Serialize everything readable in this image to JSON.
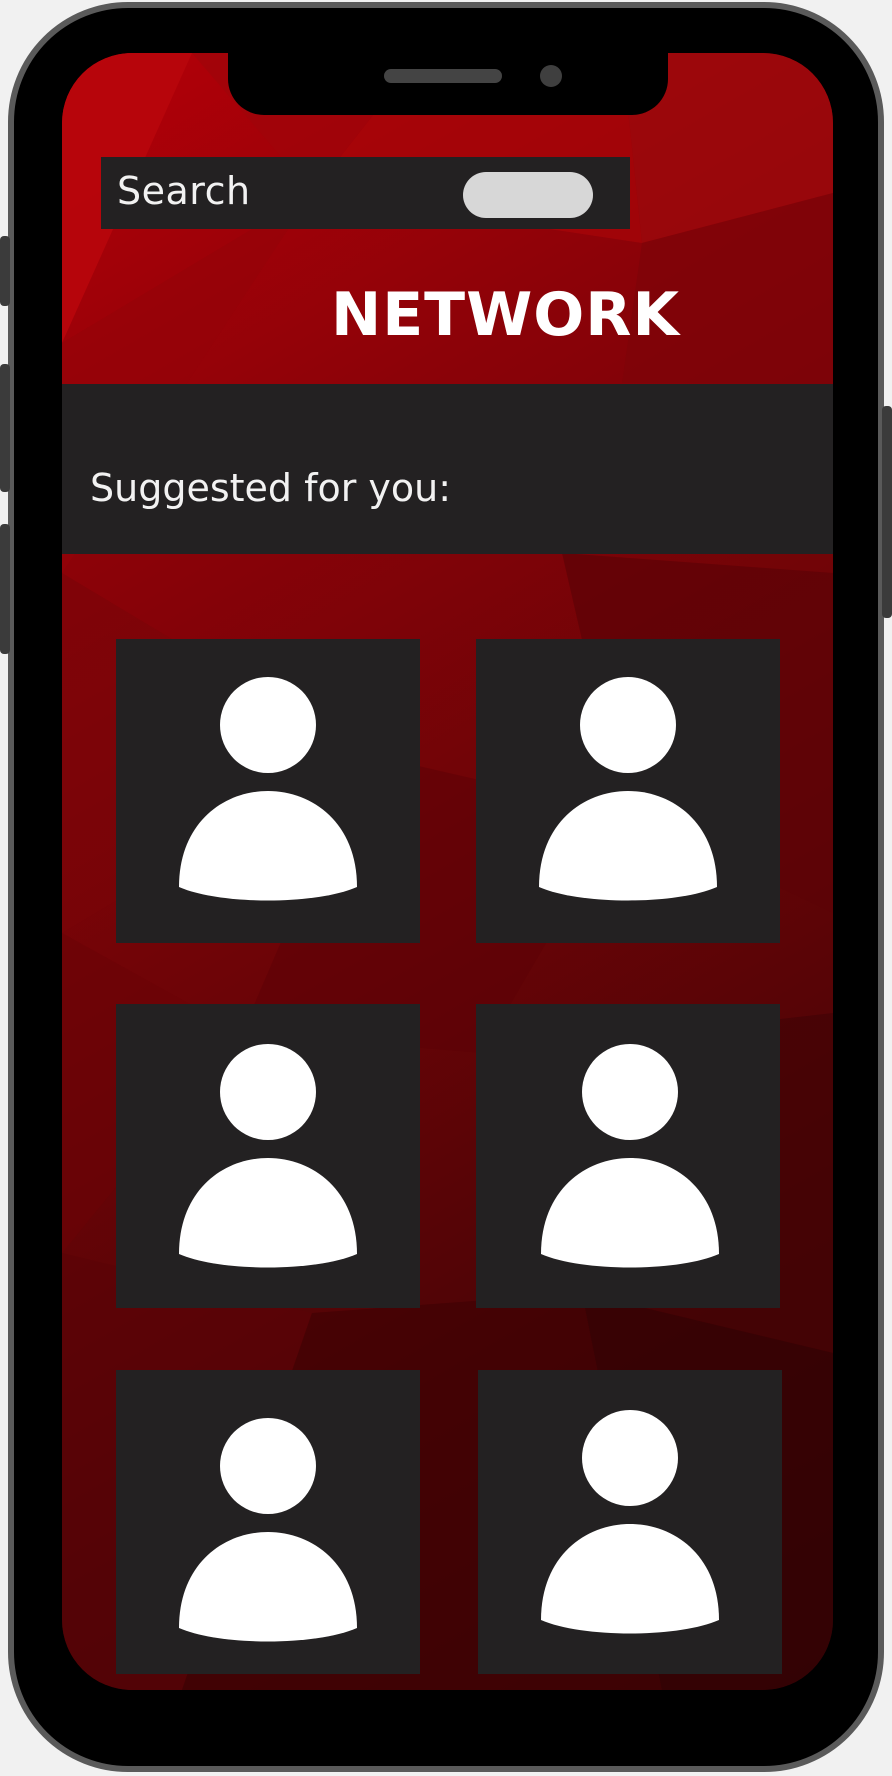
{
  "search": {
    "label": "Search"
  },
  "header": {
    "title": "NETWORK"
  },
  "section": {
    "label": "Suggested for you:"
  },
  "suggestions": [
    {
      "icon": "user-avatar-icon"
    },
    {
      "icon": "user-avatar-icon"
    },
    {
      "icon": "user-avatar-icon"
    },
    {
      "icon": "user-avatar-icon"
    },
    {
      "icon": "user-avatar-icon"
    },
    {
      "icon": "user-avatar-icon"
    }
  ],
  "colors": {
    "background_red": "#9a0309",
    "panel_dark": "#232122",
    "text_light": "#f2f2f2",
    "search_pill": "#d7d7d7"
  }
}
